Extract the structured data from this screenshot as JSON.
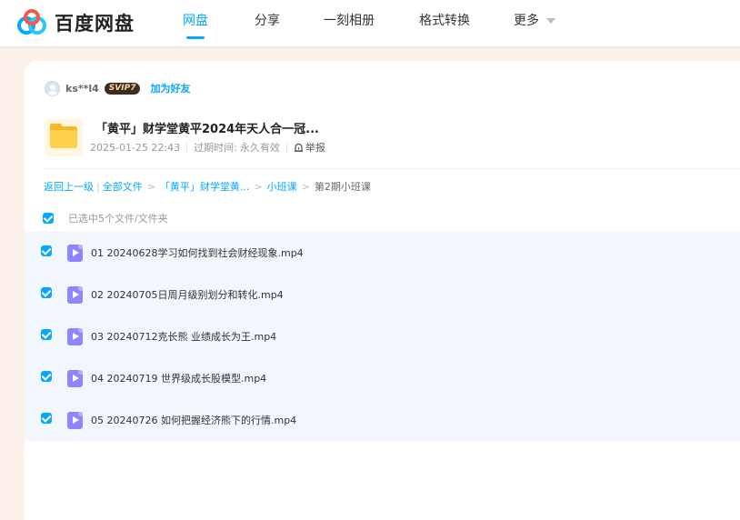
{
  "brand": {
    "name": "百度网盘"
  },
  "nav": [
    {
      "label": "网盘",
      "active": true
    },
    {
      "label": "分享",
      "active": false
    },
    {
      "label": "一刻相册",
      "active": false
    },
    {
      "label": "格式转换",
      "active": false
    },
    {
      "label": "更多",
      "active": false,
      "dropdown": true
    }
  ],
  "sharer": {
    "username": "ks**l4",
    "vip_badge": "SVIP7",
    "add_friend": "加为好友"
  },
  "share": {
    "title": "「黄平」财学堂黄平2024年天人合一冠...",
    "date": "2025-01-25 22:43",
    "expire_label": "过期时间:",
    "expire_value": "永久有效",
    "report": "举报"
  },
  "breadcrumb": {
    "back": "返回上一级",
    "all_files": "全部文件",
    "items": [
      "「黄平」财学堂黄...",
      "小班课"
    ],
    "current": "第2期小班课"
  },
  "selection": {
    "text": "已选中5个文件/文件夹",
    "checked": true
  },
  "files": [
    {
      "name": "01 20240628学习如何找到社会财经现象.mp4",
      "checked": true
    },
    {
      "name": "02 20240705日周月级别划分和转化.mp4",
      "checked": true
    },
    {
      "name": "03 20240712克长熊 业绩成长为王.mp4",
      "checked": true
    },
    {
      "name": "04 20240719 世界级成长股模型.mp4",
      "checked": true
    },
    {
      "name": "05 20240726 如何把握经济熊下的行情.mp4",
      "checked": true
    }
  ],
  "colors": {
    "accent": "#06a7ff",
    "page_bg": "#fbf0ea",
    "list_bg": "#f1f7fd",
    "folder": "#f8b727",
    "video": "#8d87ff"
  }
}
